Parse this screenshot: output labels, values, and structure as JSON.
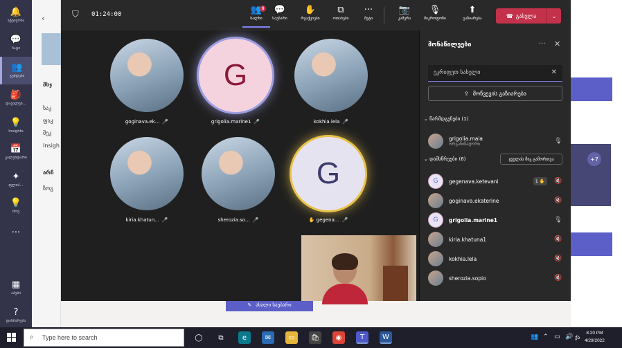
{
  "rail": {
    "items": [
      {
        "icon": "bell-icon",
        "glyph": "🔔",
        "label": "აქტივობა"
      },
      {
        "icon": "chat-icon",
        "glyph": "💬",
        "label": "ჩატი"
      },
      {
        "icon": "teams-icon",
        "glyph": "👥",
        "label": "გუნდები"
      },
      {
        "icon": "assignments-icon",
        "glyph": "🎒",
        "label": "დავალებ..."
      },
      {
        "icon": "insights-icon",
        "glyph": "💡",
        "label": "Insights"
      },
      {
        "icon": "calendar-icon",
        "glyph": "📅",
        "label": "კალენდარი"
      },
      {
        "icon": "sparkle-icon",
        "glyph": "✦",
        "label": "ფლიპ..."
      },
      {
        "icon": "help-bulb-icon",
        "glyph": "💡",
        "label": "შოუ"
      },
      {
        "icon": "more-icon",
        "glyph": "···",
        "label": ""
      },
      {
        "icon": "apps-icon",
        "glyph": "▦",
        "label": "აპები"
      },
      {
        "icon": "help-icon",
        "glyph": "?",
        "label": "დახმარება"
      }
    ]
  },
  "background": {
    "side_texts": [
      "მსჯ",
      "საკ",
      "ფაკ",
      "შეკ",
      "Insigh",
      "არჩ",
      "ზოგ"
    ],
    "meeting_chat_button": "ახალი საუბარი"
  },
  "meeting": {
    "timer": "01:24:00",
    "toolbar": [
      {
        "name": "people-icon",
        "glyph": "👥",
        "label": "ხალხი",
        "badge": "8",
        "active": true
      },
      {
        "name": "chat-icon",
        "glyph": "💬",
        "label": "საუბარი"
      },
      {
        "name": "raise-hand-icon",
        "glyph": "✋",
        "label": "რეაქციები"
      },
      {
        "name": "rooms-icon",
        "glyph": "⧉",
        "label": "ოთახები"
      },
      {
        "name": "more-icon",
        "glyph": "···",
        "label": "მეტი"
      },
      {
        "name": "camera-icon",
        "glyph": "📷",
        "label": "კამერა"
      },
      {
        "name": "mic-icon",
        "glyph": "🎙",
        "label": "მიკროფონი"
      },
      {
        "name": "share-icon",
        "glyph": "⬆",
        "label": "გაზიარება"
      }
    ],
    "leave_label": "გასვლა",
    "tiles": [
      {
        "type": "photo",
        "name": "goginava.ek..."
      },
      {
        "type": "initial",
        "initial": "G",
        "name": "grigolia.marine1",
        "bg": "#f5d3de",
        "fg": "#8b1a3a",
        "ring": "#9b9de0"
      },
      {
        "type": "photo",
        "name": "kokhia.lela"
      },
      {
        "type": "photo",
        "name": "kiria.khatun..."
      },
      {
        "type": "photo",
        "name": "sherozia.so..."
      },
      {
        "type": "initial",
        "initial": "G",
        "name": "gegena...",
        "bg": "#e6e3f1",
        "fg": "#3b3a6b",
        "ring": "#e8c24a",
        "hand": true
      }
    ]
  },
  "pane": {
    "title": "მონაწილეები",
    "search_placeholder": "ეკრიფეთ სახელი",
    "share_label": "მოწვევის გაზიარება",
    "organizers_header": "წარმდგენები (1)",
    "attendees_header": "დამსწრეები (6)",
    "mute_all": "ყველას მიკ გამორთვა",
    "organizer": {
      "name": "grigolia.maia",
      "sub": "ორგანიზატორი"
    },
    "attendees": [
      {
        "name": "gegenava.ketevani",
        "initial": "G",
        "hand_count": "1 ✋"
      },
      {
        "name": "goginava.ekaterine"
      },
      {
        "name": "grigolia.marine1",
        "initial": "G",
        "bold": true
      },
      {
        "name": "kiria.khatuna1"
      },
      {
        "name": "kokhia.lela"
      },
      {
        "name": "sherozia.sopio"
      }
    ]
  },
  "taskbar": {
    "search_placeholder": "Type here to search",
    "time": "8:20 PM",
    "date": "4/29/2022",
    "lang": "ქა"
  }
}
